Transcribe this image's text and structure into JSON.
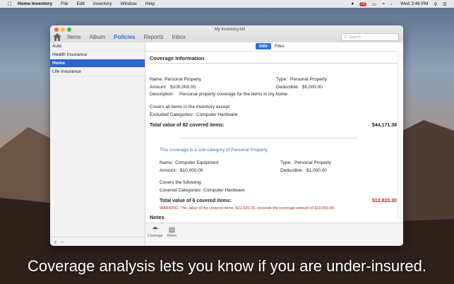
{
  "menubar": {
    "app": "Home Inventory",
    "menus": [
      "File",
      "Edit",
      "Inventory",
      "Window",
      "Help"
    ],
    "badge_count": "19",
    "clock": "Wed 3:46 PM"
  },
  "window": {
    "doc_title": "My Inventory.hi3",
    "tabs": [
      "Items",
      "Album",
      "Policies",
      "Reports",
      "Inbox"
    ],
    "search_placeholder": "Search"
  },
  "sidebar": {
    "items": [
      "Auto",
      "Health Insurance",
      "Home",
      "Life Insurance"
    ]
  },
  "segments": [
    "Info",
    "Files"
  ],
  "coverage": {
    "section_title": "Coverage Information",
    "name_label": "Name:",
    "name_value": "Personal Property",
    "type_label": "Type:",
    "type_value": "Personal Property",
    "amount_label": "Amount:",
    "amount_value": "$100,000.00",
    "deductible_label": "Deductible:",
    "deductible_value": "$5,000.00",
    "description_label": "Description:",
    "description_value": "Personal property coverage for the items in my home.",
    "covers_text": "Covers all items in the inventory except:",
    "excluded_label": "Excluded Categories:",
    "excluded_value": "Computer Hardware",
    "total_label": "Total value of 82 covered items:",
    "total_value": "$44,171.38"
  },
  "subcoverage": {
    "note": "This coverage is a sub-category of Personal Property",
    "name_label": "Name:",
    "name_value": "Computer Equipment",
    "type_label": "Type:",
    "type_value": "Personal Property",
    "amount_label": "Amount:",
    "amount_value": "$10,000.00",
    "deductible_label": "Deductible:",
    "deductible_value": "$1,000.00",
    "covers_text": "Covers the following:",
    "covered_label": "Covered Categories:",
    "covered_value": "Computer Hardware",
    "total_label": "Total value of 6 covered items:",
    "total_value": "$12,820.30",
    "warning": "WARNING:  The value of the covered items, $12,820.30, exceeds the coverage amount of $10,000.00."
  },
  "notes_title": "Notes",
  "bottom_toolbar": [
    "Coverage",
    "Notes"
  ],
  "sidebar_footer": [
    "+",
    "−"
  ],
  "caption": "Coverage analysis lets you know if you are under-insured.",
  "colors": {
    "accent": "#2b63d6",
    "warning": "#b2281c"
  }
}
